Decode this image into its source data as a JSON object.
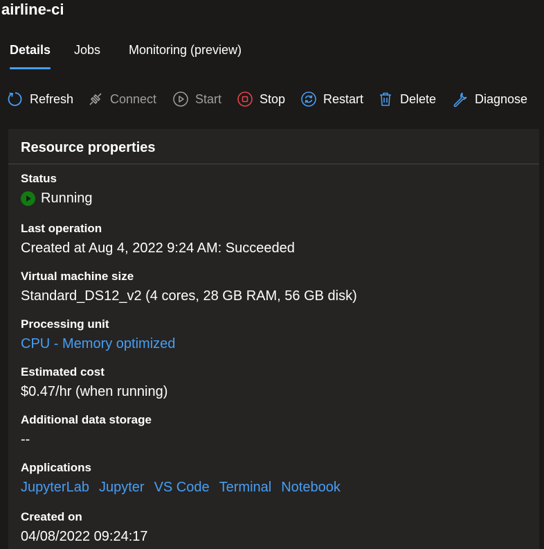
{
  "header": {
    "title": "airline-ci"
  },
  "tabs": [
    {
      "label": "Details",
      "active": true
    },
    {
      "label": "Jobs",
      "active": false
    },
    {
      "label": "Monitoring (preview)",
      "active": false
    }
  ],
  "toolbar": {
    "refresh": {
      "label": "Refresh",
      "icon": "refresh-icon",
      "enabled": true
    },
    "connect": {
      "label": "Connect",
      "icon": "plug-icon",
      "enabled": false
    },
    "start": {
      "label": "Start",
      "icon": "play-icon",
      "enabled": false
    },
    "stop": {
      "label": "Stop",
      "icon": "stop-icon",
      "enabled": true
    },
    "restart": {
      "label": "Restart",
      "icon": "restart-icon",
      "enabled": true
    },
    "delete": {
      "label": "Delete",
      "icon": "trash-icon",
      "enabled": true
    },
    "diagnose": {
      "label": "Diagnose",
      "icon": "wrench-icon",
      "enabled": true
    }
  },
  "card": {
    "title": "Resource properties",
    "status": {
      "label": "Status",
      "value": "Running",
      "icon": "running-status-icon"
    },
    "last_operation": {
      "label": "Last operation",
      "value": "Created at Aug 4, 2022 9:24 AM: Succeeded"
    },
    "vm_size": {
      "label": "Virtual machine size",
      "value": "Standard_DS12_v2 (4 cores, 28 GB RAM, 56 GB disk)"
    },
    "processing_unit": {
      "label": "Processing unit",
      "value": "CPU - Memory optimized"
    },
    "estimated_cost": {
      "label": "Estimated cost",
      "value": "$0.47/hr (when running)"
    },
    "additional_storage": {
      "label": "Additional data storage",
      "value": "--"
    },
    "applications": {
      "label": "Applications",
      "items": [
        "JupyterLab",
        "Jupyter",
        "VS Code",
        "Terminal",
        "Notebook"
      ]
    },
    "created_on": {
      "label": "Created on",
      "value": "04/08/2022 09:24:17"
    }
  },
  "colors": {
    "background": "#1b1a19",
    "card": "#252423",
    "accent": "#479ef5",
    "stop_red": "#e8414a",
    "running_green": "#107c10",
    "disabled_text": "#a19f9d"
  }
}
